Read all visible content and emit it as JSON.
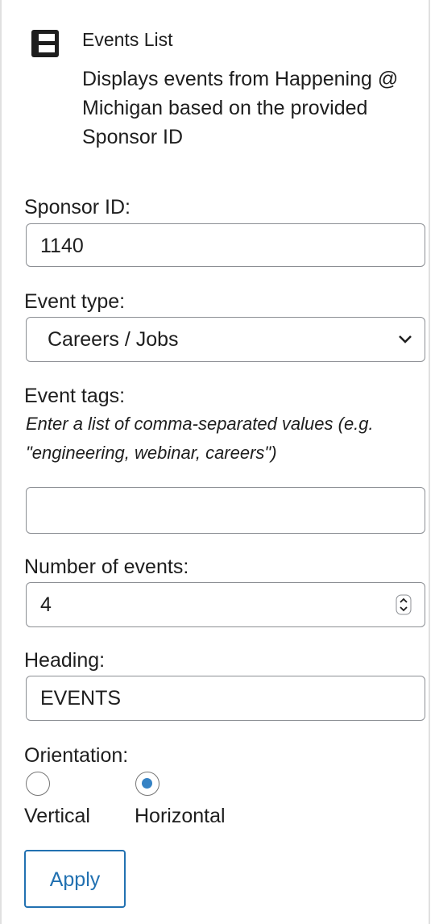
{
  "block": {
    "title": "Events List",
    "description": "Displays events from Happening @ Michigan based on the provided Sponsor ID",
    "icon": "block-table-icon"
  },
  "form": {
    "sponsor": {
      "label": "Sponsor ID:",
      "value": "1140"
    },
    "event_type": {
      "label": "Event type:",
      "value": "Careers / Jobs",
      "icon": "chevron-down-icon"
    },
    "event_tags": {
      "label": "Event tags:",
      "hint": "Enter a list of comma-separated values (e.g. \"engineering, webinar, careers\")",
      "value": ""
    },
    "number_of_events": {
      "label": "Number of events:",
      "value": "4",
      "icon": "spinner-icon"
    },
    "heading": {
      "label": "Heading:",
      "value": "EVENTS"
    },
    "orientation": {
      "label": "Orientation:",
      "options": [
        "Vertical",
        "Horizontal"
      ],
      "selected": "Horizontal"
    },
    "apply_label": "Apply"
  },
  "colors": {
    "accent": "#2271b1",
    "radio_selected": "#3582c4",
    "border": "#8c8f94",
    "text": "#1e1e1e"
  }
}
